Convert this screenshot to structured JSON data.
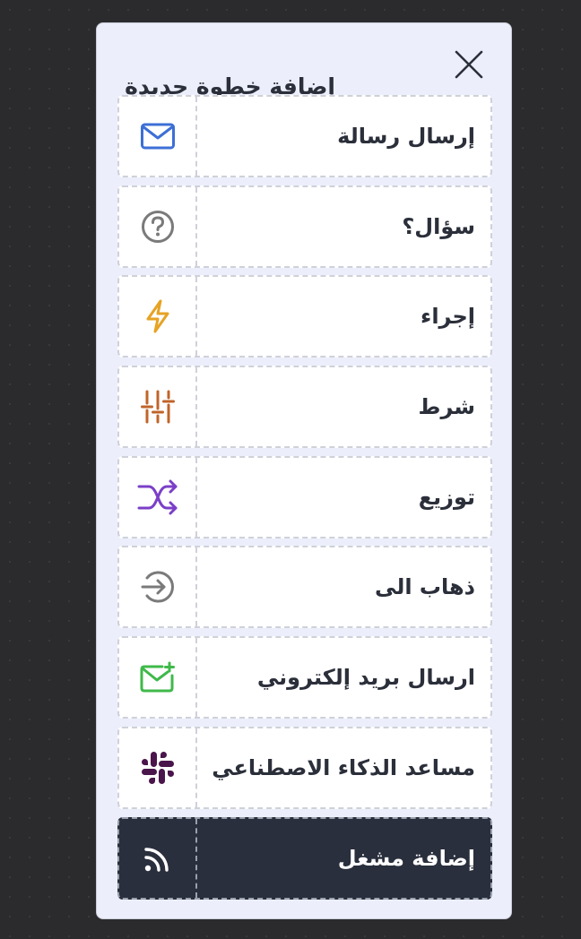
{
  "dialog": {
    "title": "إضافة خطوة جديدة",
    "close_icon": "close-icon"
  },
  "steps": [
    {
      "label": "إرسال رسالة",
      "icon": "envelope-icon",
      "color": "#3d6fd6"
    },
    {
      "label": "سؤال؟",
      "icon": "question-circle-icon",
      "color": "#7a7a7a"
    },
    {
      "label": "إجراء",
      "icon": "lightning-icon",
      "color": "#e6a324"
    },
    {
      "label": "شرط",
      "icon": "sliders-icon",
      "color": "#c0642a"
    },
    {
      "label": "توزيع",
      "icon": "shuffle-icon",
      "color": "#7b3fc8"
    },
    {
      "label": "ذهاب الى",
      "icon": "arrow-right-circle-icon",
      "color": "#7a7a7a"
    },
    {
      "label": "ارسال بريد إلكتروني",
      "icon": "mail-plus-icon",
      "color": "#3fb94a"
    },
    {
      "label": "مساعد الذكاء الاصطناعي",
      "icon": "slack-icon",
      "color": "#4a154b"
    },
    {
      "label": "إضافة مشغل",
      "icon": "rss-icon",
      "color": "#ffffff"
    }
  ]
}
